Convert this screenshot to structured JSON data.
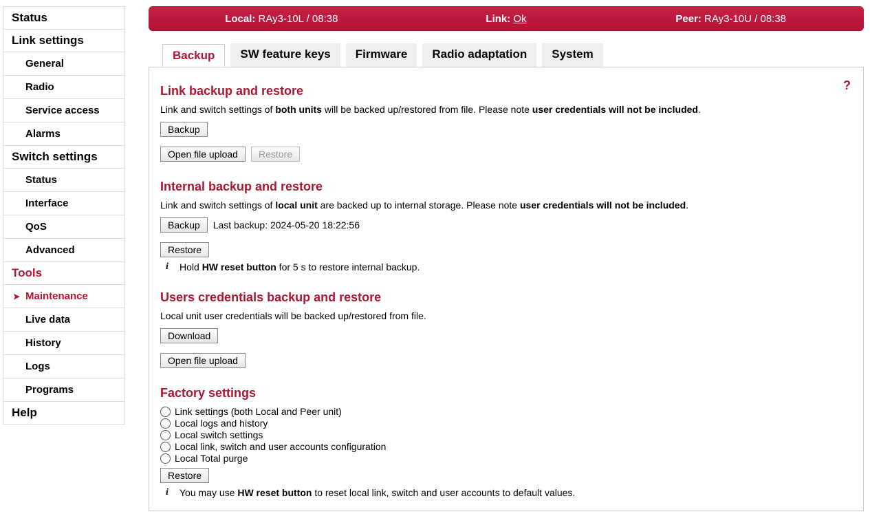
{
  "sidebar": {
    "status": "Status",
    "link_settings": "Link settings",
    "link_items": [
      "General",
      "Radio",
      "Service access",
      "Alarms"
    ],
    "switch_settings": "Switch settings",
    "switch_items": [
      "Status",
      "Interface",
      "QoS",
      "Advanced"
    ],
    "tools": "Tools",
    "tools_items": [
      "Maintenance",
      "Live data",
      "History",
      "Logs",
      "Programs"
    ],
    "tools_active_index": 0,
    "help": "Help"
  },
  "header": {
    "local_label": "Local:",
    "local_value": "RAy3-10L / 08:38",
    "link_label": "Link:",
    "link_value": "Ok",
    "peer_label": "Peer:",
    "peer_value": "RAy3-10U / 08:38"
  },
  "tabs": [
    "Backup",
    "SW feature keys",
    "Firmware",
    "Radio adaptation",
    "System"
  ],
  "active_tab_index": 0,
  "help_icon": "?",
  "sections": {
    "link_backup": {
      "title": "Link backup and restore",
      "desc_pre": "Link and switch settings of ",
      "desc_bold1": "both units",
      "desc_mid": " will be backed up/restored from file. Please note ",
      "desc_bold2": "user credentials will not be included",
      "desc_post": ".",
      "backup_btn": "Backup",
      "open_btn": "Open file upload",
      "restore_btn": "Restore"
    },
    "internal_backup": {
      "title": "Internal backup and restore",
      "desc_pre": "Link and switch settings of ",
      "desc_bold1": "local unit",
      "desc_mid": " are backed up to internal storage. Please note ",
      "desc_bold2": "user credentials will not be included",
      "desc_post": ".",
      "backup_btn": "Backup",
      "last_backup_label": "Last backup: ",
      "last_backup_value": "2024-05-20 18:22:56",
      "restore_btn": "Restore",
      "hint_pre": "Hold ",
      "hint_bold": "HW reset button",
      "hint_post": " for 5 s to restore internal backup."
    },
    "user_creds": {
      "title": "Users credentials backup and restore",
      "desc": "Local unit user credentials will be backed up/restored from file.",
      "download_btn": "Download",
      "open_btn": "Open file upload"
    },
    "factory": {
      "title": "Factory settings",
      "options": [
        "Link settings (both Local and Peer unit)",
        "Local logs and history",
        "Local switch settings",
        "Local link, switch and user accounts configuration",
        "Local Total purge"
      ],
      "restore_btn": "Restore",
      "hint_pre": "You may use ",
      "hint_bold": "HW reset button",
      "hint_post": " to reset local link, switch and user accounts to default values."
    }
  }
}
